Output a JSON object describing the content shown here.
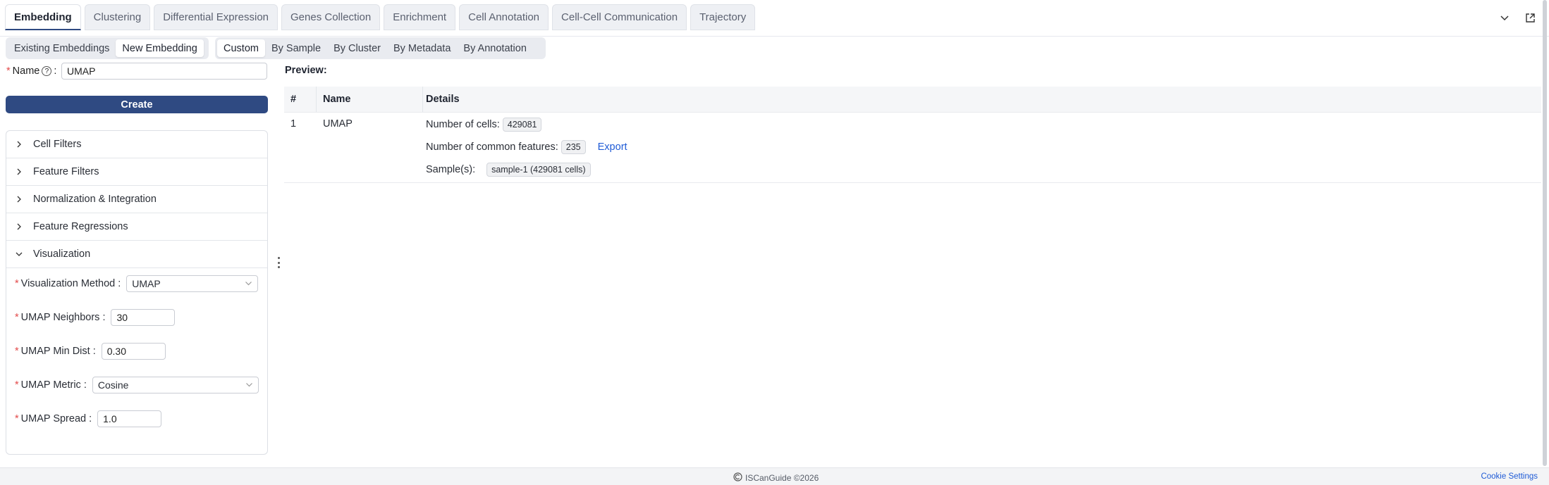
{
  "tabs": [
    {
      "label": "Embedding"
    },
    {
      "label": "Clustering"
    },
    {
      "label": "Differential Expression"
    },
    {
      "label": "Genes Collection"
    },
    {
      "label": "Enrichment"
    },
    {
      "label": "Cell Annotation"
    },
    {
      "label": "Cell-Cell Communication"
    },
    {
      "label": "Trajectory"
    }
  ],
  "subtabs_left": [
    {
      "label": "Existing Embeddings"
    },
    {
      "label": "New Embedding"
    }
  ],
  "subtabs_right": [
    {
      "label": "Custom"
    },
    {
      "label": "By Sample"
    },
    {
      "label": "By Cluster"
    },
    {
      "label": "By Metadata"
    },
    {
      "label": "By Annotation"
    }
  ],
  "form": {
    "name_label": "Name",
    "name_value": "UMAP",
    "create_label": "Create"
  },
  "accordion": [
    {
      "label": "Cell Filters"
    },
    {
      "label": "Feature Filters"
    },
    {
      "label": "Normalization & Integration"
    },
    {
      "label": "Feature Regressions"
    },
    {
      "label": "Visualization"
    }
  ],
  "viz": {
    "method_label": "Visualization Method",
    "method_value": "UMAP",
    "neighbors_label": "UMAP Neighbors",
    "neighbors_value": "30",
    "mindist_label": "UMAP Min Dist",
    "mindist_value": "0.30",
    "metric_label": "UMAP Metric",
    "metric_value": "Cosine",
    "spread_label": "UMAP Spread",
    "spread_value": "1.0"
  },
  "preview": {
    "title": "Preview:",
    "headers": {
      "num": "#",
      "name": "Name",
      "details": "Details"
    },
    "row": {
      "num": "1",
      "name": "UMAP",
      "cells_label": "Number of cells:",
      "cells_value": "429081",
      "features_label": "Number of common features:",
      "features_value": "235",
      "export_label": "Export",
      "samples_label": "Sample(s):",
      "sample_pill": "sample-1 (429081 cells)"
    }
  },
  "footer": {
    "brand": "ISCanGuide ©2026",
    "cookie": "Cookie Settings"
  },
  "colors": {
    "primary": "#2f4a82",
    "link": "#1f5bd6",
    "required": "#e34b4b"
  }
}
